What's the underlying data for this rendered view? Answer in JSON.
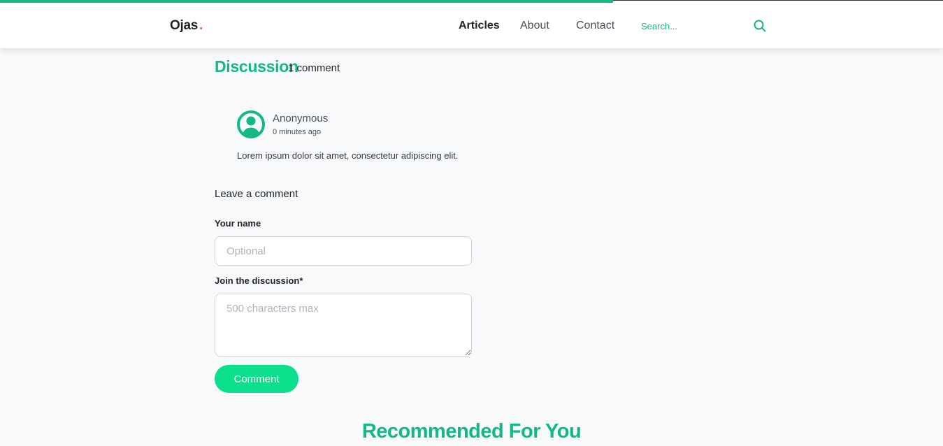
{
  "reading_progress": {
    "fraction": 0.65,
    "color": "#12b886"
  },
  "brand": {
    "name": "Ojas",
    "dot": ".",
    "dot_color": "#fa5252"
  },
  "nav": {
    "links": [
      {
        "label": "Articles",
        "active": true
      },
      {
        "label": "About",
        "active": false
      },
      {
        "label": "Contact",
        "active": false
      }
    ],
    "search": {
      "placeholder": "Search...",
      "value": "",
      "icon": "search-icon"
    }
  },
  "discussion": {
    "title": "Discussion",
    "count_label": "1 comment",
    "comments": [
      {
        "author": "Anonymous",
        "time": "0 minutes ago",
        "text": "Lorem ipsum dolor sit amet, consectetur adipiscing elit.",
        "avatar_icon": "user-avatar-icon"
      }
    ]
  },
  "form": {
    "title": "Leave a comment",
    "name_label": "Your name",
    "name_placeholder": "Optional",
    "name_value": "",
    "discussion_label": "Join the discussion*",
    "discussion_placeholder": "500 characters max",
    "discussion_value": "",
    "submit_label": "Comment"
  },
  "recommended": {
    "title": "Recommended For You"
  },
  "colors": {
    "accent": "#12b886",
    "button": "#0ce08c",
    "background": "#f8f9fa"
  }
}
